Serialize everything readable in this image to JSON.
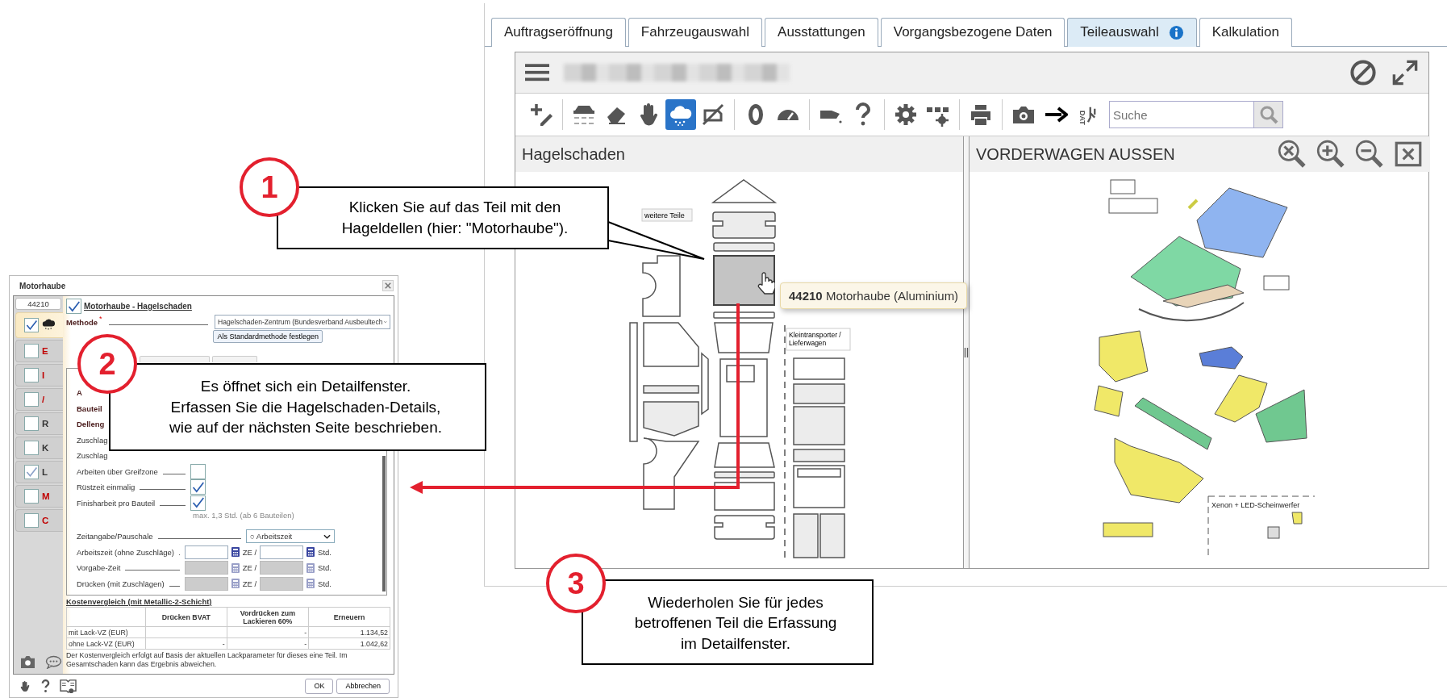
{
  "app": {
    "tabs": [
      {
        "label": "Auftragseröffnung",
        "selected": false,
        "info": false
      },
      {
        "label": "Fahrzeugauswahl",
        "selected": false,
        "info": false
      },
      {
        "label": "Ausstattungen",
        "selected": false,
        "info": false
      },
      {
        "label": "Vorgangsbezogene Daten",
        "selected": false,
        "info": false
      },
      {
        "label": "Teileauswahl",
        "selected": true,
        "info": true
      },
      {
        "label": "Kalkulation",
        "selected": false,
        "info": false
      }
    ],
    "tool_groups": [
      [
        {
          "kind": "add-edit",
          "selected": false
        }
      ],
      [
        {
          "kind": "car-list",
          "selected": false
        },
        {
          "kind": "eraser",
          "selected": false
        },
        {
          "kind": "hand",
          "selected": false
        },
        {
          "kind": "hail",
          "selected": true
        },
        {
          "kind": "no-engine",
          "selected": false
        }
      ],
      [
        {
          "kind": "tire",
          "selected": false
        },
        {
          "kind": "gauge",
          "selected": false
        }
      ],
      [
        {
          "kind": "oil-can",
          "selected": false
        },
        {
          "kind": "question",
          "selected": false
        }
      ],
      [
        {
          "kind": "gear",
          "selected": false
        },
        {
          "kind": "dots-gear",
          "selected": false
        }
      ],
      [
        {
          "kind": "printer",
          "selected": false
        }
      ],
      [
        {
          "kind": "camera",
          "selected": false
        },
        {
          "kind": "arrow",
          "selected": false
        },
        {
          "kind": "dat",
          "selected": false,
          "label": "DAT"
        }
      ]
    ],
    "search": {
      "placeholder": "Suche"
    },
    "left_pane": {
      "title": "Hagelschaden",
      "labels": [
        "weitere Teile",
        "Kleintransporter / Lieferwagen"
      ],
      "tooltip": {
        "number": "44210",
        "text": "Motorhaube (Aluminium)"
      }
    },
    "right_pane": {
      "title": "VORDERWAGEN AUSSEN",
      "label": "Xenon + LED-Scheinwerfer"
    }
  },
  "dialog": {
    "title": "Motorhaube",
    "part_number": "44210",
    "sidebar_tabs": [
      {
        "kind": "hail",
        "checked": true,
        "selected": true
      },
      {
        "kind": "letter",
        "label": "E",
        "checked": false,
        "selected": false,
        "color": "#c00000"
      },
      {
        "kind": "letter",
        "label": "I",
        "checked": false,
        "selected": false,
        "color": "#c00000"
      },
      {
        "kind": "letter",
        "label": "/",
        "checked": false,
        "selected": false,
        "color": "#c00000"
      },
      {
        "kind": "letter",
        "label": "R",
        "checked": false,
        "selected": false,
        "color": "#333333"
      },
      {
        "kind": "letter",
        "label": "K",
        "checked": false,
        "selected": false,
        "color": "#333333"
      },
      {
        "kind": "letter",
        "label": "L",
        "checked": true,
        "selected": false,
        "color": "#333333"
      },
      {
        "kind": "letter",
        "label": "M",
        "checked": false,
        "selected": false,
        "color": "#c00000"
      },
      {
        "kind": "letter",
        "label": "C",
        "checked": false,
        "selected": false,
        "color": "#c00000"
      }
    ],
    "heading": {
      "text": "Motorhaube - Hagelschaden",
      "checked": true
    },
    "method": {
      "label": "Methode",
      "required_mark": "*",
      "value": "Hagelschaden-Zentrum (Bundesverband Ausbeultech"
    },
    "default_button": "Als Standardmethode festlegen",
    "rows": [
      {
        "kind": "bold",
        "label": "A"
      },
      {
        "kind": "bold",
        "label": "Bauteil"
      },
      {
        "kind": "bold",
        "label": "Delleng"
      },
      {
        "kind": "plain",
        "label": "Zuschlag"
      },
      {
        "kind": "plain",
        "label": "Zuschlag"
      },
      {
        "kind": "check",
        "label": "Arbeiten über Greifzone",
        "checked": false
      },
      {
        "kind": "check",
        "label": "Rüstzeit einmalig",
        "checked": true
      },
      {
        "kind": "check",
        "label": "Finisharbeit pro Bauteil",
        "checked": true
      }
    ],
    "hint": "max. 1,3 Std. (ab 6 Bauteilen)",
    "time_select": {
      "label": "Zeitangabe/Pauschale",
      "value": "○ Arbeitszeit"
    },
    "time_rows": [
      {
        "label": "Arbeitszeit (ohne Zuschläge)",
        "disabled": false,
        "unit_1": "ZE /",
        "unit_2": "Std."
      },
      {
        "label": "Vorgabe-Zeit",
        "disabled": true,
        "unit_1": "ZE /",
        "unit_2": "Std."
      },
      {
        "label": "Drücken (mit Zuschlägen)",
        "disabled": true,
        "unit_1": "ZE /",
        "unit_2": "Std."
      }
    ],
    "cost": {
      "title": "Kostenvergleich (mit Metallic-2-Schicht)",
      "columns": [
        "",
        "Drücken BVAT",
        "Vordrücken zum Lackieren 60%",
        "Erneuern"
      ],
      "rows": [
        [
          "mit Lack-VZ (EUR)",
          "",
          "-",
          "1.134,52"
        ],
        [
          "ohne Lack-VZ (EUR)",
          "-",
          "-",
          "1.042,62"
        ]
      ],
      "note": "Der Kostenvergleich erfolgt auf Basis der aktuellen Lackparameter für dieses eine Teil. Im Gesamtschaden kann das Ergebnis abweichen."
    },
    "buttons": [
      "OK",
      "Abbrechen"
    ]
  },
  "callouts": [
    {
      "number": "1",
      "lines": [
        "Klicken Sie auf das Teil mit den",
        "Hageldellen (hier: \"Motorhaube\")."
      ]
    },
    {
      "number": "2",
      "lines": [
        "Es öffnet sich ein Detailfenster.",
        "Erfassen Sie die Hagelschaden-Details,",
        "wie auf der nächsten Seite beschrieben."
      ]
    },
    {
      "number": "3",
      "lines": [
        "Wiederholen Sie für jedes",
        "betroffenen Teil die Erfassung",
        "im Detailfenster."
      ]
    }
  ]
}
